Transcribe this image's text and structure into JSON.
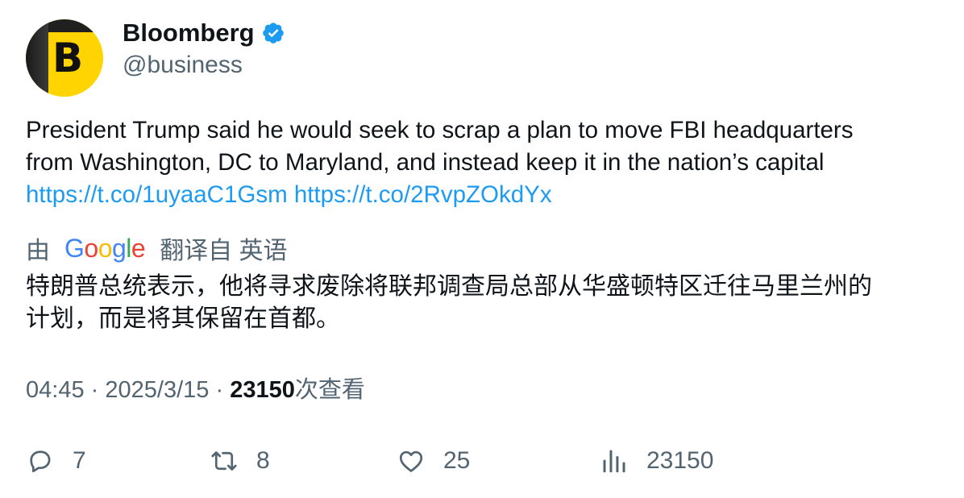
{
  "author": {
    "avatar_letter": "B",
    "display_name": "Bloomberg",
    "handle": "@business",
    "verified_color": "#1d9bf0"
  },
  "tweet": {
    "text_line1": "President Trump said he would seek to scrap a plan to move FBI headquarters",
    "text_line2": "from Washington, DC to Maryland, and instead keep it in the nation’s capital",
    "link1": "https://t.co/1uyaaC1Gsm",
    "link2": "https://t.co/2RvpZOkdYx"
  },
  "translation": {
    "prefix": "由",
    "provider_letters": [
      "G",
      "o",
      "o",
      "g",
      "l",
      "e"
    ],
    "suffix": "翻译自 英语",
    "text_line1": "特朗普总统表示，他将寻求废除将联邦调查局总部从华盛顿特区迁往马里兰州的",
    "text_line2": "计划，而是将其保留在首都。"
  },
  "meta": {
    "time": "04:45",
    "separator": "·",
    "date": "2025/3/15",
    "views_count": "23150",
    "views_label": "次查看"
  },
  "actions": {
    "reply_count": "7",
    "retweet_count": "8",
    "like_count": "25",
    "views_count": "23150"
  },
  "colors": {
    "link": "#1d9bf0",
    "secondary_text": "#536471",
    "primary_text": "#0f1419",
    "avatar_yellow": "#ffd400"
  },
  "icons": {
    "reply": "reply-icon",
    "retweet": "retweet-icon",
    "like": "heart-icon",
    "views": "views-chart-icon",
    "verified": "verified-badge-icon"
  }
}
